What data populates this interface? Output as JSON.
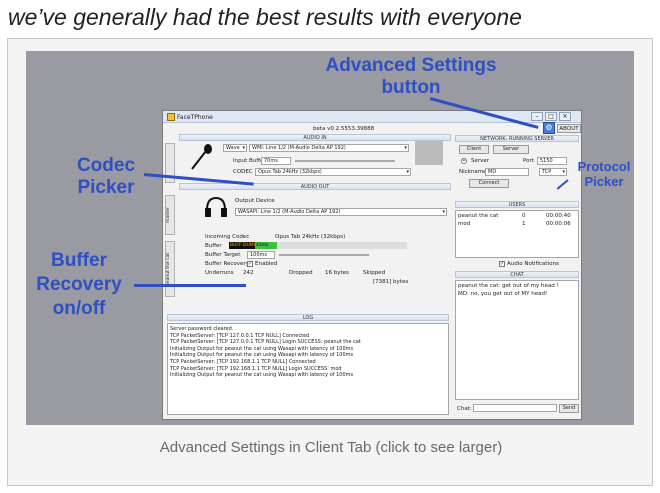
{
  "heading": "we’ve generally had the best results with everyone",
  "caption": "Advanced Settings in Client Tab (click to see larger)",
  "colors": {
    "annotation": "#2f4fc4",
    "accent_button": "#4a7cd6"
  },
  "annotations": {
    "advanced": [
      "Advanced Settings",
      "button"
    ],
    "codec": [
      "Codec",
      "Picker"
    ],
    "buffer": [
      "Buffer",
      "Recovery",
      "on/off"
    ],
    "protocol": [
      "Protocol",
      "Picker"
    ]
  },
  "app": {
    "title": "FaceTPhone",
    "version": "beta v0.2.5553.39888",
    "about_label": "ABOUT",
    "advanced_icon": "gear-icon",
    "window_buttons": [
      "–",
      "□",
      "✕"
    ],
    "audio_in": {
      "header": "AUDIO IN",
      "driver": "Wave",
      "device": "WMI: Line 1/2 (M-Audio Delta AP 192)",
      "input_buffer_label": "Input Buffer",
      "input_buffer_value": "70ms",
      "codec_label": "CODEC",
      "codec_value": "Opus Tab 24kHz (32kbps)"
    },
    "audio_out": {
      "header": "AUDIO OUT",
      "output_device_label": "Output Device",
      "output_device_value": "WASAPI: Line 1/2 (M-Audio Delta AP 192)"
    },
    "side_tabs": [
      "master",
      "peanut the cat"
    ],
    "incoming": {
      "codec_label": "Incoming Codec",
      "codec_value": "Opus Tab 24kHz (32kbps)",
      "buffer_label": "Buffer",
      "buffer_bar": "BUFF DUMP",
      "buffer_value": "43ms",
      "buffer_target_label": "Buffer Target",
      "buffer_target_value": "100ms",
      "recovery_label": "Buffer Recovery",
      "enabled_label": "Enabled",
      "underruns_label": "Underruns",
      "underruns_value": "242",
      "dropped_label": "Dropped",
      "dropped_value": "16 bytes",
      "skipped_label": "Skipped",
      "skipped_value": "[7381] bytes"
    },
    "log": {
      "header": "LOG",
      "lines": [
        "Server password cleared.",
        "TCP PacketServer: [TCP 127.0.0.1 TCP NULL] Connected",
        "TCP PacketServer: [TCP 127.0.0.1 TCP NULL] Login SUCCESS: peanut the cat",
        "Initializing Output for peanut the cat using Wasapi with latency of 100ms",
        "Initializing Output for peanut the cat using Wasapi with latency of 100ms",
        "TCP PacketServer: [TCP 192.168.1.1 TCP NULL] Connected",
        "TCP PacketServer: [TCP 192.168.1.1 TCP NULL] Login SUCCESS: mod",
        "Initializing Output for peanut the cat using Wasapi with latency of 100ms"
      ]
    },
    "network": {
      "header": "NETWORK: RUNNING SERVER",
      "tabs": [
        "Client",
        "Server"
      ],
      "server_label": "Server",
      "port_label": "Port",
      "port_value": "5150",
      "nickname_label": "Nickname",
      "nickname_value": "MD",
      "protocol_value": "TCP",
      "connect_label": "Connect"
    },
    "users": {
      "header": "USERS",
      "rows": [
        {
          "name": "peanut the cat",
          "count": "0",
          "time": "00:00:40"
        },
        {
          "name": "mod",
          "count": "1",
          "time": "00:00:06"
        }
      ]
    },
    "audio_notifications": "Audio Notifications",
    "chat": {
      "header": "CHAT",
      "messages": [
        "peanut the cat: get out of my head !",
        "MD: no, you get out of MY head!"
      ],
      "input_label": "Chat:",
      "send_label": "Send"
    }
  }
}
